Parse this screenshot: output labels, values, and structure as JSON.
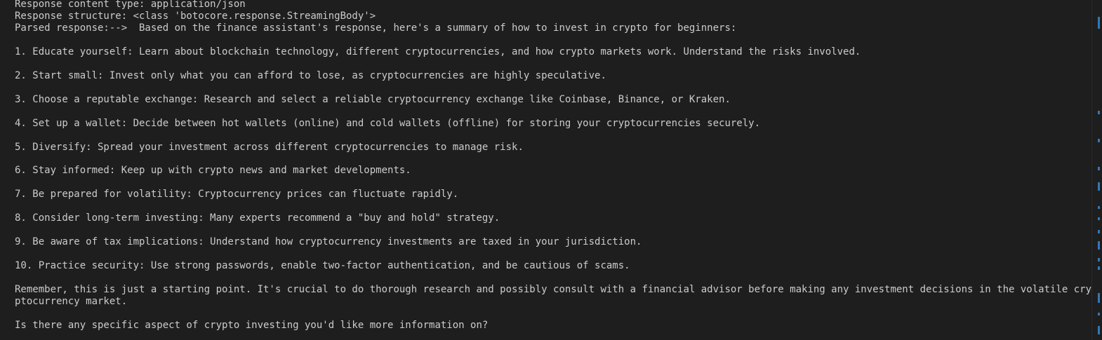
{
  "terminal": {
    "lines": [
      "Response content type: application/json",
      "Response structure: <class 'botocore.response.StreamingBody'>",
      "Parsed response:-->  Based on the finance assistant's response, here's a summary of how to invest in crypto for beginners:",
      "",
      "1. Educate yourself: Learn about blockchain technology, different cryptocurrencies, and how crypto markets work. Understand the risks involved.",
      "",
      "2. Start small: Invest only what you can afford to lose, as cryptocurrencies are highly speculative.",
      "",
      "3. Choose a reputable exchange: Research and select a reliable cryptocurrency exchange like Coinbase, Binance, or Kraken.",
      "",
      "4. Set up a wallet: Decide between hot wallets (online) and cold wallets (offline) for storing your cryptocurrencies securely.",
      "",
      "5. Diversify: Spread your investment across different cryptocurrencies to manage risk.",
      "",
      "6. Stay informed: Keep up with crypto news and market developments.",
      "",
      "7. Be prepared for volatility: Cryptocurrency prices can fluctuate rapidly.",
      "",
      "8. Consider long-term investing: Many experts recommend a \"buy and hold\" strategy.",
      "",
      "9. Be aware of tax implications: Understand how cryptocurrency investments are taxed in your jurisdiction.",
      "",
      "10. Practice security: Use strong passwords, enable two-factor authentication, and be cautious of scams.",
      "",
      "Remember, this is just a starting point. It's crucial to do thorough research and possibly consult with a financial advisor before making any investment decisions in the volatile cry",
      "ptocurrency market.",
      "",
      "Is there any specific aspect of crypto investing you'd like more information on?"
    ]
  },
  "colors": {
    "background": "#1e1e1e",
    "text": "#cccccc",
    "scroll_marker": "#2f78b7"
  }
}
